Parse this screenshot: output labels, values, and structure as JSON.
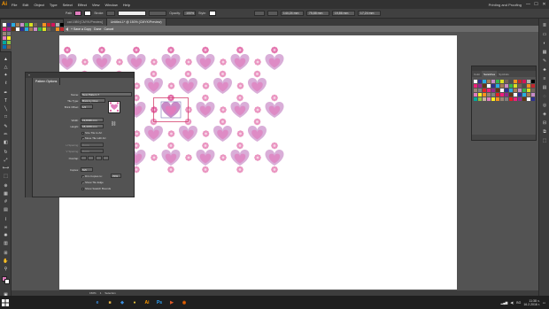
{
  "app": {
    "logo": "Ai",
    "menu": [
      "File",
      "Edit",
      "Object",
      "Type",
      "Select",
      "Effect",
      "View",
      "Window",
      "Help"
    ],
    "workspace": "Printing and Proofing",
    "window_controls": [
      "—",
      "☐",
      "✕"
    ]
  },
  "controlbar": {
    "selection_label": "Path",
    "stroke_label": "Stroke:",
    "opacity_label": "Opacity:",
    "opacity_value": "100%",
    "style_label": "Style:",
    "x_value": "144,24 mm",
    "y_value": "75,88 mm",
    "w_value": "19,86 mm",
    "h_value": "17,24 mm"
  },
  "tabs": [
    {
      "label": "cat 1989 [CMYK/Preview]",
      "active": false
    },
    {
      "label": "Untitled-1* @ 150% (CMYK/Preview)",
      "active": true
    }
  ],
  "pattern_bar": {
    "save_copy": "+ Save a Copy",
    "done": "Done",
    "cancel": "Cancel"
  },
  "pattern_panel": {
    "collapse_label": "«",
    "tab": "Pattern Options",
    "name_label": "Name:",
    "name_value": "New Pattern 7",
    "tile_type_label": "Tile Type:",
    "tile_type_value": "Brick by Row",
    "brick_offset_label": "Brick Offset:",
    "brick_offset_value": "1/2",
    "width_label": "Width:",
    "width_value": "19,8436 mm",
    "height_label": "Height:",
    "height_value": "18,4159 mm",
    "size_tile_label": "Size Tile to Art",
    "move_tile_label": "Move Tile with Art",
    "h_spacing_label": "H Spacing:",
    "h_spacing_value": "0 mm",
    "v_spacing_label": "V Spacing:",
    "v_spacing_value": "0 mm",
    "overlap_label": "Overlap:",
    "copies_label": "Copies:",
    "copies_value": "5x5",
    "dim_copies_label": "Dim Copies to:",
    "dim_copies_value": "70%",
    "show_tile_edge_label": "Show Tile Edge",
    "show_swatch_bounds_label": "Show Swatch Bounds"
  },
  "swatches_panel": {
    "tabs": [
      "Color",
      "Swatches",
      "Symbols"
    ],
    "active_tab": "Swatches"
  },
  "statusbar": {
    "zoom": "150%",
    "page": "1",
    "tool": "Selection"
  },
  "taskbar": {
    "apps": [
      {
        "name": "edge",
        "label": "e",
        "color": "#3b8ede"
      },
      {
        "name": "explorer",
        "label": "■",
        "color": "#e8b64a"
      },
      {
        "name": "store",
        "label": "◆",
        "color": "#3b8ede"
      },
      {
        "name": "chrome",
        "label": "●",
        "color": "#e2c23c"
      },
      {
        "name": "illustrator",
        "label": "Ai",
        "color": "#ff9a00"
      },
      {
        "name": "photoshop",
        "label": "Ps",
        "color": "#31a8ff"
      },
      {
        "name": "media",
        "label": "▶",
        "color": "#e05a2a"
      },
      {
        "name": "firefox",
        "label": "◉",
        "color": "#e66000"
      }
    ],
    "language": "BG",
    "time": "11:38 ч.",
    "date": "16.2.2016 г."
  },
  "colors": {
    "heart_outer": "#c98bc7",
    "heart_inner": "#e07cbd",
    "flower_petal": "#e26ba8",
    "flower_center": "#f3c2de",
    "tile_edge": "#d5436f"
  }
}
